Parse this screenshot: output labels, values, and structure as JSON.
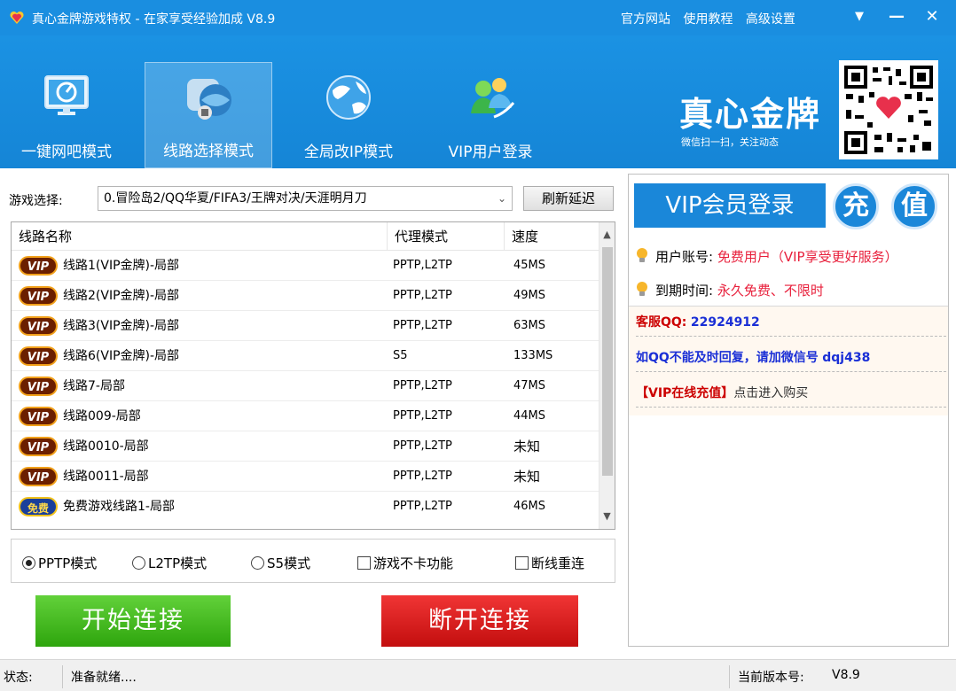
{
  "window": {
    "title": "真心金牌游戏特权 - 在家享受经验加成 V8.9",
    "links": [
      "官方网站",
      "使用教程",
      "高级设置"
    ],
    "controls": {
      "menu": "▼",
      "minimize": "—",
      "close": "✕"
    }
  },
  "header": {
    "modes": [
      {
        "label": "一键网吧模式",
        "icon": "monitor-icon"
      },
      {
        "label": "线路选择模式",
        "icon": "internet-cafe-globe-icon",
        "active": true
      },
      {
        "label": "全局改IP模式",
        "icon": "globe-icon"
      },
      {
        "label": "VIP用户登录",
        "icon": "users-icon"
      }
    ],
    "brand": "真心金牌",
    "brand_sub": "微信扫一扫，关注动态"
  },
  "game_select": {
    "label": "游戏选择:",
    "value": "0.冒险岛2/QQ华夏/FIFA3/王牌对决/天涯明月刀",
    "refresh_label": "刷新延迟"
  },
  "routes": {
    "columns": [
      "线路名称",
      "代理模式",
      "速度"
    ],
    "rows": [
      {
        "badge": "VIP",
        "name": "线路1(VIP金牌)-局部",
        "mode": "PPTP,L2TP",
        "speed": "45MS"
      },
      {
        "badge": "VIP",
        "name": "线路2(VIP金牌)-局部",
        "mode": "PPTP,L2TP",
        "speed": "49MS"
      },
      {
        "badge": "VIP",
        "name": "线路3(VIP金牌)-局部",
        "mode": "PPTP,L2TP",
        "speed": "63MS"
      },
      {
        "badge": "VIP",
        "name": "线路6(VIP金牌)-局部",
        "mode": "S5",
        "speed": "133MS"
      },
      {
        "badge": "VIP",
        "name": "线路7-局部",
        "mode": "PPTP,L2TP",
        "speed": "47MS"
      },
      {
        "badge": "VIP",
        "name": "线路009-局部",
        "mode": "PPTP,L2TP",
        "speed": "44MS"
      },
      {
        "badge": "VIP",
        "name": "线路0010-局部",
        "mode": "PPTP,L2TP",
        "speed": "未知"
      },
      {
        "badge": "VIP",
        "name": "线路0011-局部",
        "mode": "PPTP,L2TP",
        "speed": "未知"
      },
      {
        "badge": "免费",
        "name": "免费游戏线路1-局部",
        "mode": "PPTP,L2TP",
        "speed": "46MS"
      }
    ]
  },
  "options": {
    "pptp": {
      "label": "PPTP模式",
      "selected": true
    },
    "l2tp": {
      "label": "L2TP模式",
      "selected": false
    },
    "s5": {
      "label": "S5模式",
      "selected": false
    },
    "no_lag": {
      "label": "游戏不卡功能",
      "checked": false
    },
    "reconnect": {
      "label": "断线重连",
      "checked": false
    }
  },
  "buttons": {
    "start": "开始连接",
    "stop": "断开连接"
  },
  "right": {
    "vip_login": "VIP会员登录",
    "recharge_1": "充",
    "recharge_2": "值",
    "account_label": "用户账号:",
    "account_value": "免费用户（VIP享受更好服务）",
    "expire_label": "到期时间:",
    "expire_value": "永久免费、不限时",
    "qq_label": "客服QQ:",
    "qq_value": "22924912",
    "wechat_text": "如QQ不能及时回复，请加微信号",
    "wechat_id": "dqj438",
    "recharge_link_bold": "【VIP在线充值】",
    "recharge_link_text": "点击进入购买"
  },
  "status": {
    "label": "状态:",
    "value": "准备就绪....",
    "version_label": "当前版本号:",
    "version_value": "V8.9"
  },
  "colors": {
    "title_blue": "#1a8ee0",
    "start_green": "#2ea50d",
    "stop_red": "#c30e0e",
    "accent_red": "#e8203c",
    "link_blue": "#1a2fd6"
  }
}
